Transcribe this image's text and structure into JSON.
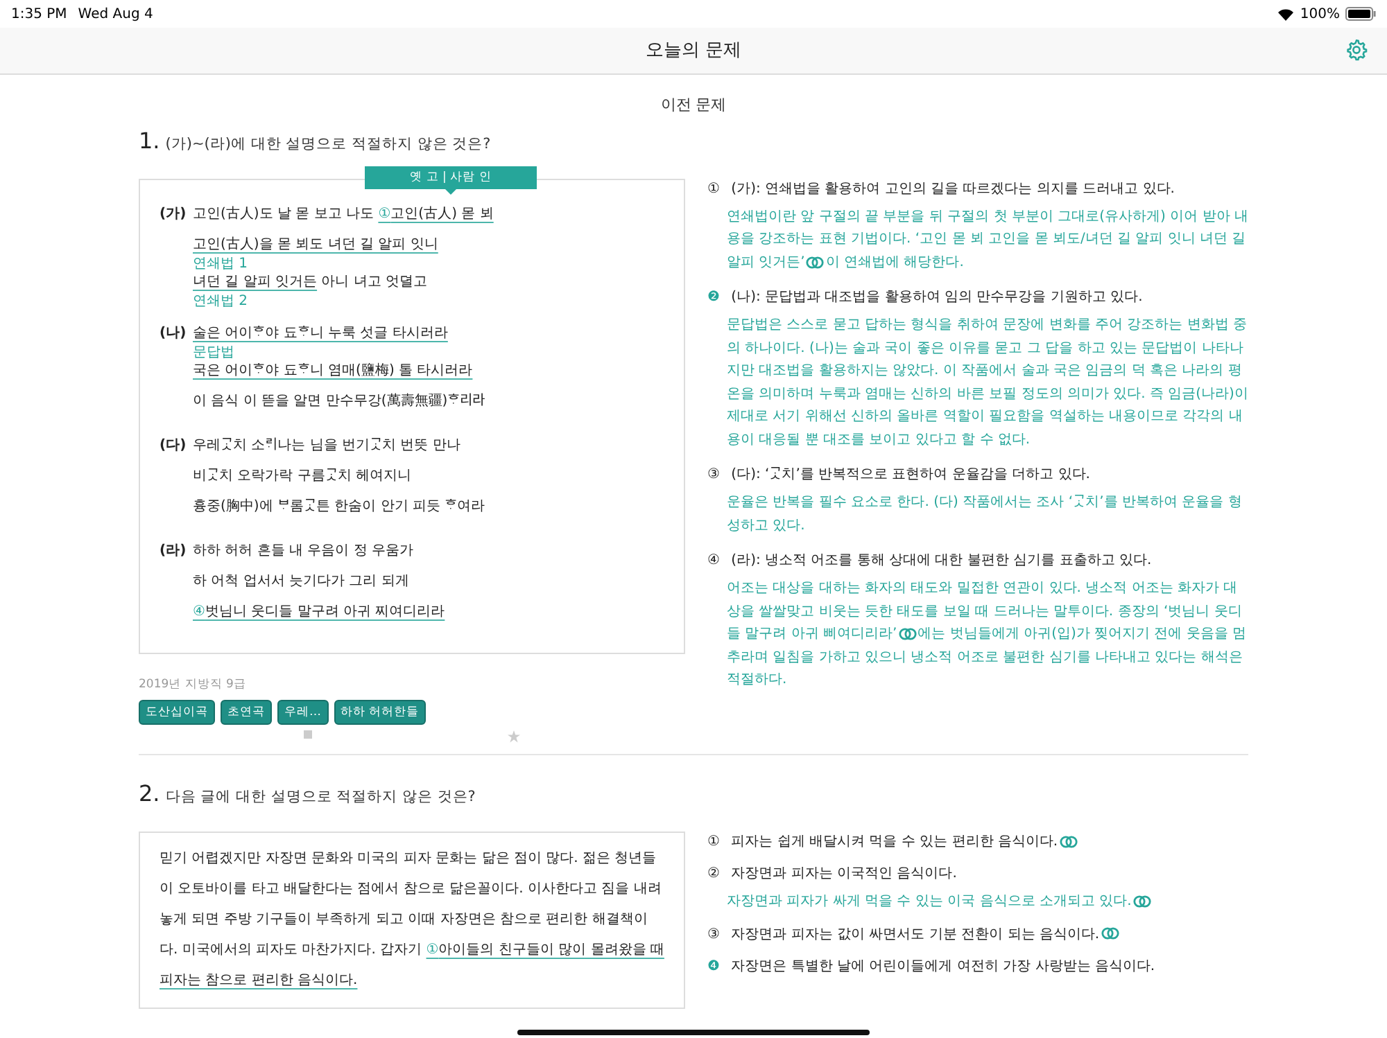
{
  "status_bar": {
    "time": "1:35 PM",
    "date": "Wed Aug 4",
    "battery": "100%"
  },
  "nav": {
    "title": "오늘의 문제"
  },
  "prev_link": "이전 문제",
  "questions": [
    {
      "number": "1.",
      "prompt": "(가)~(라)에 대한 설명으로 적절하지 않은 것은?",
      "tooltip": "옛 고 | 사람 인",
      "stanzas": [
        {
          "label": "(가)",
          "lines": [
            {
              "kind": "text",
              "segments": [
                {
                  "kind": "plain",
                  "text": "고인(古人)도 날 몯 보고 나도 "
                },
                {
                  "kind": "marker",
                  "text": "①"
                },
                {
                  "kind": "underline",
                  "text": "고인(古人) 몯 뵈"
                }
              ]
            },
            {
              "kind": "text",
              "segments": [
                {
                  "kind": "underline",
                  "text": "고인(古人)을 몯 뵈도 녀던 길 알피 잇니"
                }
              ]
            },
            {
              "kind": "note",
              "text": "연쇄법 1"
            },
            {
              "kind": "text",
              "segments": [
                {
                  "kind": "underline",
                  "text": "녀던 길 알피 잇거든"
                },
                {
                  "kind": "plain",
                  "text": " 아니 녀고 엇뎔고"
                }
              ]
            },
            {
              "kind": "note",
              "text": "연쇄법 2"
            }
          ]
        },
        {
          "label": "(나)",
          "lines": [
            {
              "kind": "text",
              "segments": [
                {
                  "kind": "underline",
                  "text": "술은 어이ᄒᆞ야 됴ᄒᆞ니 누룩 섯글 타시러라"
                }
              ]
            },
            {
              "kind": "note",
              "text": "문답법"
            },
            {
              "kind": "text",
              "segments": [
                {
                  "kind": "underline",
                  "text": "국은 어이ᄒᆞ야 됴ᄒᆞ니 염매(鹽梅) 톨 타시러라"
                }
              ]
            },
            {
              "kind": "text",
              "segments": [
                {
                  "kind": "plain",
                  "text": "이 음식 이 뜯을 알면 만수무강(萬壽無疆)ᄒᆞ리라"
                }
              ]
            }
          ]
        },
        {
          "label": "(다)",
          "lines": [
            {
              "kind": "text",
              "segments": [
                {
                  "kind": "plain",
                  "text": "우레ᄀᆞᆺ치 소ᄅᆡ나는 님을 번기ᄀᆞᆺ치 번뜻 만나"
                }
              ]
            },
            {
              "kind": "text",
              "segments": [
                {
                  "kind": "plain",
                  "text": "비ᄀᆞᆺ치 오락가락 구름ᄀᆞᆺ치 헤여지니"
                }
              ]
            },
            {
              "kind": "text",
              "segments": [
                {
                  "kind": "plain",
                  "text": "흉중(胸中)에 ᄇᆞ롬ᄀᆞᆺ튼 한숨이 안기 피듯 ᄒᆞ여라"
                }
              ]
            }
          ]
        },
        {
          "label": "(라)",
          "lines": [
            {
              "kind": "text",
              "segments": [
                {
                  "kind": "plain",
                  "text": "하하 허허 흔들 내 우음이 정 우움가"
                }
              ]
            },
            {
              "kind": "text",
              "segments": [
                {
                  "kind": "plain",
                  "text": "하 어척 업서서 늣기다가 그리 되게"
                }
              ]
            },
            {
              "kind": "text",
              "segments": [
                {
                  "kind": "marker",
                  "text": "④"
                },
                {
                  "kind": "underline",
                  "text": "벗님니 웃디들 말구려 아귀 찌여디리라"
                }
              ]
            }
          ]
        }
      ],
      "source": "2019년 지방직 9급",
      "tags": [
        "도산십이곡",
        "초연곡",
        "우레…",
        "하하 허허한들"
      ],
      "choices": [
        {
          "marker": "①",
          "answer": false,
          "statement": "(가): 연쇄법을 활용하여 고인의 길을 따르겠다는 의지를 드러내고 있다.",
          "statement_link": false,
          "explanation": "연쇄법이란 앞 구절의 끝 부분을 뒤 구절의 첫 부분이 그대로(유사하게) 이어 받아 내용을 강조하는 표현 기법이다. ‘고인 몯 뵈 고인을 몯 뵈도/녀던 길 알피 잇니 녀던 길 알피 잇거든’",
          "explanation_link": true,
          "explanation_tail": "이 연쇄법에 해당한다."
        },
        {
          "marker": "❷",
          "answer": true,
          "statement": "(나): 문답법과 대조법을 활용하여 임의 만수무강을 기원하고 있다.",
          "statement_link": false,
          "explanation": "문답법은 스스로 묻고 답하는 형식을 취하여 문장에 변화를 주어 강조하는 변화법 중의 하나이다. (나)는 술과 국이 좋은 이유를 묻고 그 답을 하고 있는 문답법이 나타나지만 대조법을 활용하지는 않았다. 이 작품에서 술과 국은 임금의 덕 혹은 나라의 평온을 의미하며 누룩과 염매는 신하의 바른 보필 정도의 의미가 있다. 즉 임금(나라)이 제대로 서기 위해선 신하의 올바른 역할이 필요함을 역설하는 내용이므로 각각의 내용이 대응될 뿐 대조를 보이고 있다고 할 수 없다.",
          "explanation_link": false
        },
        {
          "marker": "③",
          "answer": false,
          "statement": "(다): ‘ᄀᆞᆺ치’를 반복적으로 표현하여 운율감을 더하고 있다.",
          "statement_link": false,
          "explanation": "운율은 반복을 필수 요소로 한다. (다) 작품에서는 조사 ‘ᄀᆞᆺ치’를 반복하여 운율을 형성하고 있다.",
          "explanation_link": false
        },
        {
          "marker": "④",
          "answer": false,
          "statement": "(라): 냉소적 어조를 통해 상대에 대한 불편한 심기를 표출하고 있다.",
          "statement_link": false,
          "explanation": "어조는 대상을 대하는 화자의 태도와 밀접한 연관이 있다. 냉소적 어조는 화자가 대상을 쌀쌀맞고 비웃는 듯한 태도를 보일 때 드러나는 말투이다. 종장의 ‘벗님니 웃디들 말구려 아귀 삐여디리라’",
          "explanation_link": true,
          "explanation_tail": "에는 벗님들에게 아귀(입)가 찢어지기 전에 웃음을 멈추라며 일침을 가하고 있으니 냉소적 어조로 불편한 심기를 나타내고 있다는 해석은 적절하다."
        }
      ]
    },
    {
      "number": "2.",
      "prompt": "다음 글에 대한 설명으로 적절하지 않은 것은?",
      "paragraph": [
        {
          "kind": "plain",
          "text": "믿기 어렵겠지만 자장면 문화와 미국의 피자 문화는 닮은 점이 많다. 젊은 청년들이 오토바이를 타고 배달한다는 점에서 참으로 닮은꼴이다. 이사한다고 짐을 내려놓게 되면 주방 기구들이 부족하게 되고 이때 자장면은 참으로 편리한 해결책이다. 미국에서의 피자도 마찬가지다. 갑자기 "
        },
        {
          "kind": "marker",
          "text": "①"
        },
        {
          "kind": "underline",
          "text": "아이들의 친구들이 많이 몰려왔을 때 피자는 참으로 편리한 음식이다."
        }
      ],
      "choices": [
        {
          "marker": "①",
          "answer": false,
          "statement": "피자는 쉽게 배달시켜 먹을 수 있는 편리한 음식이다.",
          "statement_link": true
        },
        {
          "marker": "②",
          "answer": false,
          "statement": "자장면과 피자는 이국적인 음식이다.",
          "statement_link": false,
          "explanation": "자장면과 피자가 싸게 먹을 수 있는 이국 음식으로 소개되고 있다.",
          "explanation_link": true
        },
        {
          "marker": "③",
          "answer": false,
          "statement": "자장면과 피자는 값이 싸면서도 기분 전환이 되는 음식이다.",
          "statement_link": true
        },
        {
          "marker": "❹",
          "answer": true,
          "statement": "자장면은 특별한 날에 어린이들에게 여전히 가장 사랑받는 음식이다.",
          "statement_link": false
        }
      ]
    }
  ]
}
